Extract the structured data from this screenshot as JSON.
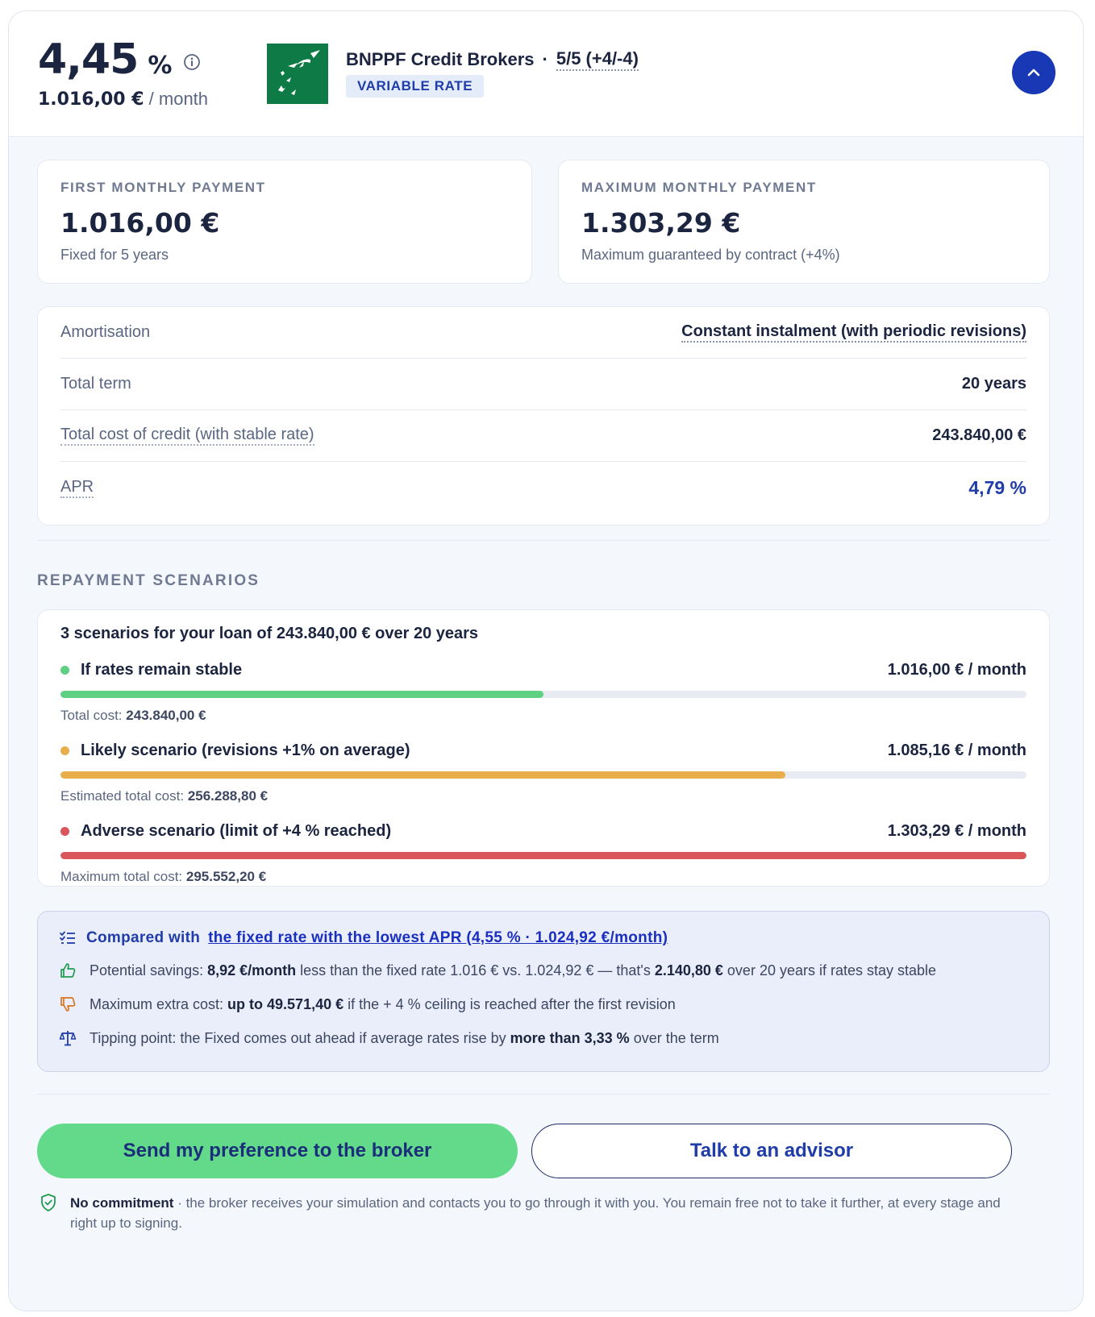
{
  "header": {
    "rate": "4,45",
    "rate_unit": "%",
    "monthly_amount": "1.016,00 €",
    "monthly_suffix": "/ month",
    "broker_name": "BNPPF Credit Brokers",
    "separator": "·",
    "rate_type_score": "5/5 (+4/-4)",
    "rate_type_tag": "VARIABLE RATE",
    "logo_bg": "#0e7a45",
    "accent": "#1838b6"
  },
  "payments": {
    "first": {
      "label": "FIRST MONTHLY PAYMENT",
      "amount": "1.016,00 €",
      "note": "Fixed for 5 years"
    },
    "max": {
      "label": "MAXIMUM MONTHLY PAYMENT",
      "amount": "1.303,29 €",
      "note": "Maximum guaranteed by contract (+4%)"
    }
  },
  "details": {
    "amortisation": {
      "label": "Amortisation",
      "value": "Constant instalment (with periodic revisions)"
    },
    "term": {
      "label": "Total term",
      "value": "20 years"
    },
    "total_cost": {
      "label": "Total cost of credit (with stable rate)",
      "value": "243.840,00 €"
    },
    "apr": {
      "label": "APR",
      "value": "4,79 %"
    }
  },
  "scenarios": {
    "title": "REPAYMENT SCENARIOS",
    "intro": "3 scenarios for your loan of 243.840,00 € over 20 years",
    "items": [
      {
        "name": "If rates remain stable",
        "monthly": "1.016,00 € / month",
        "cost_label": "Total cost:",
        "cost_value": "243.840,00 €",
        "color": "#5fcf82",
        "fill": 0.5
      },
      {
        "name": "Likely scenario (revisions +1% on average)",
        "monthly": "1.085,16 € / month",
        "cost_label": "Estimated total cost:",
        "cost_value": "256.288,80 €",
        "color": "#e8ae4b",
        "fill": 0.75
      },
      {
        "name": "Adverse scenario (limit of +4 % reached)",
        "monthly": "1.303,29 € / month",
        "cost_label": "Maximum total cost:",
        "cost_value": "295.552,20 €",
        "color": "#d9575a",
        "fill": 1.0
      }
    ]
  },
  "compare": {
    "prefix": "Compared with",
    "link": "the fixed rate with the lowest APR (4,55 % · 1.024,92 €/month)",
    "savings": {
      "a": "Potential savings: ",
      "b": "8,92 €/month",
      "c": " less than the fixed rate 1.016 € vs. 1.024,92 € — that's ",
      "d": "2.140,80 €",
      "e": " over 20 years if rates stay stable"
    },
    "extra": {
      "a": "Maximum extra cost: ",
      "b": "up to 49.571,40 €",
      "c": " if the + 4 % ceiling is reached after the first revision"
    },
    "tipping": {
      "a": "Tipping point: the Fixed comes out ahead if average rates rise by ",
      "b": "more than 3,33 %",
      "c": " over the term"
    }
  },
  "actions": {
    "send_label": "Send my preference to the broker",
    "advisor_label": "Talk to an advisor"
  },
  "disclaimer": {
    "bold": "No commitment",
    "sep": " · ",
    "text": "the broker receives your simulation and contacts you to go through it with you. You remain free not to take it further, at every stage and right up to signing."
  }
}
